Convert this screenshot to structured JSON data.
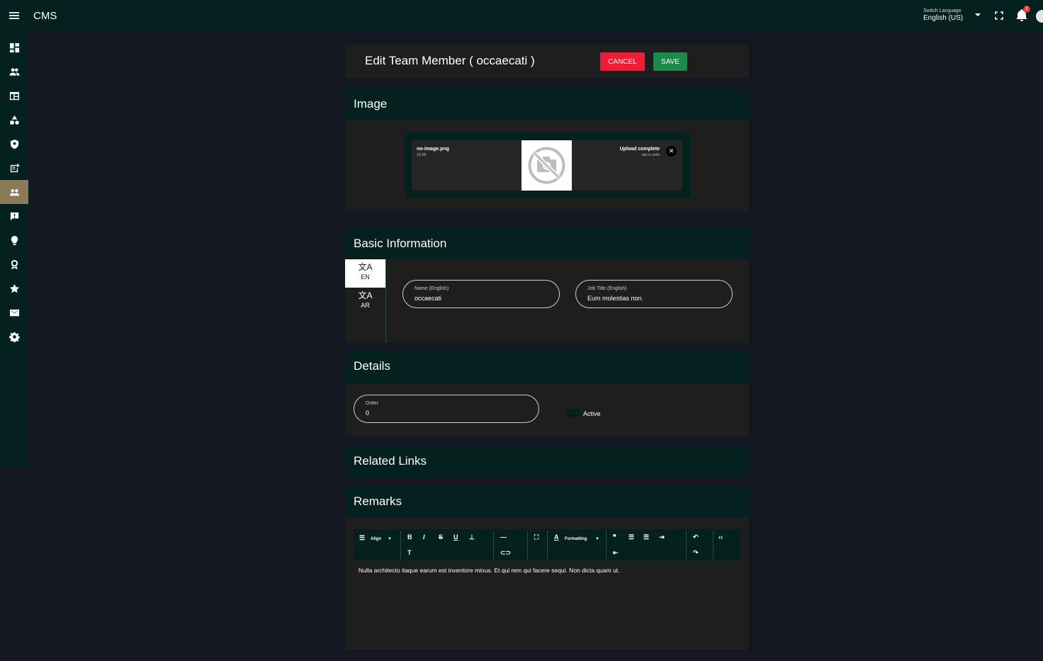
{
  "app": {
    "title": "CMS",
    "language": {
      "caption": "Switch Language",
      "value": "English (US)"
    },
    "notifications": {
      "count": "2"
    }
  },
  "sidebar": {
    "items": [
      {
        "name": "dashboard-icon"
      },
      {
        "name": "users-icon"
      },
      {
        "name": "layout-icon"
      },
      {
        "name": "shapes-icon"
      },
      {
        "name": "shield-icon"
      },
      {
        "name": "post-add-icon"
      },
      {
        "name": "team-icon",
        "active": true
      },
      {
        "name": "feedback-icon"
      },
      {
        "name": "lightbulb-icon"
      },
      {
        "name": "award-icon"
      },
      {
        "name": "star-icon"
      },
      {
        "name": "mail-icon"
      },
      {
        "name": "gear-icon"
      }
    ]
  },
  "header": {
    "title": "Edit Team Member ( occaecati )",
    "cancel_label": "CANCEL",
    "save_label": "SAVE"
  },
  "image_section": {
    "title": "Image",
    "file_name": "no-image.png",
    "file_size": "19 KB",
    "status": "Upload complete",
    "status_sub": "tap to undo"
  },
  "basic_info": {
    "title": "Basic Information",
    "tabs": [
      {
        "label": "EN",
        "active": true
      },
      {
        "label": "AR",
        "active": false
      }
    ],
    "name": {
      "label": "Name (English)",
      "value": "occaecati"
    },
    "job_title": {
      "label": "Job Title (English)",
      "value": "Eum molestias non."
    }
  },
  "details": {
    "title": "Details",
    "order": {
      "label": "Order",
      "value": "0"
    },
    "active_label": "Active"
  },
  "related_links": {
    "title": "Related Links"
  },
  "remarks": {
    "title": "Remarks",
    "toolbar": {
      "align_label": "Align",
      "formatting_label": "Formatting"
    },
    "content": "Nulla architecto itaque earum est inventore minus. Et qui rem qui facere sequi. Non dicta quam ut."
  },
  "colors": {
    "header_bg": "#04201f",
    "page_bg": "#131722",
    "card_bg": "#1e1e1f",
    "cancel": "#f01c35",
    "save": "#1d8a4a",
    "active_nav": "#8a7a5a"
  }
}
